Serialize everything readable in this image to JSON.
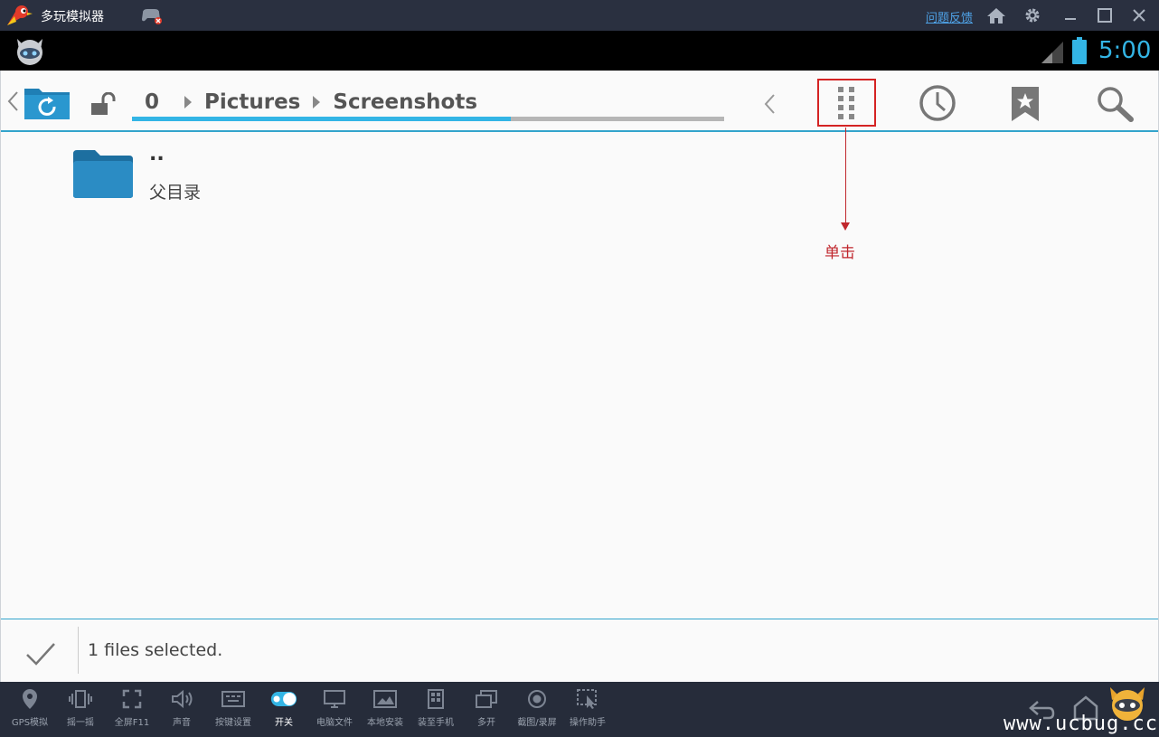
{
  "window": {
    "title": "多玩模拟器",
    "feedback_link": "问题反馈",
    "icons": [
      "home-icon",
      "gear-icon",
      "minimize-icon",
      "maximize-icon",
      "close-icon"
    ]
  },
  "statusbar": {
    "time": "5:00",
    "accent": "#33b5e5"
  },
  "file_manager": {
    "breadcrumb": [
      "0",
      "Pictures",
      "Screenshots"
    ],
    "breadcrumb_progress": 0.64,
    "files": [
      {
        "name": "..",
        "description": "父目录"
      }
    ],
    "selection_status": "1 files selected.",
    "accent": "#33a4cc"
  },
  "annotation": {
    "label": "单击",
    "color": "#c0272d"
  },
  "toolbar": {
    "items": [
      {
        "label": "GPS模拟",
        "icon": "map-pin-icon"
      },
      {
        "label": "摇一摇",
        "icon": "shake-icon"
      },
      {
        "label": "全屏F11",
        "icon": "fullscreen-icon"
      },
      {
        "label": "声音",
        "icon": "speaker-icon"
      },
      {
        "label": "按键设置",
        "icon": "keyboard-icon"
      },
      {
        "label": "开关",
        "icon": "toggle-on-icon",
        "toggle_text": "ON"
      },
      {
        "label": "电脑文件",
        "icon": "monitor-icon"
      },
      {
        "label": "本地安装",
        "icon": "image-install-icon"
      },
      {
        "label": "装至手机",
        "icon": "phone-install-icon"
      },
      {
        "label": "多开",
        "icon": "multi-window-icon"
      },
      {
        "label": "截图/录屏",
        "icon": "record-icon"
      },
      {
        "label": "操作助手",
        "icon": "assistant-icon"
      }
    ]
  },
  "watermark": "www.ucbug.cc"
}
